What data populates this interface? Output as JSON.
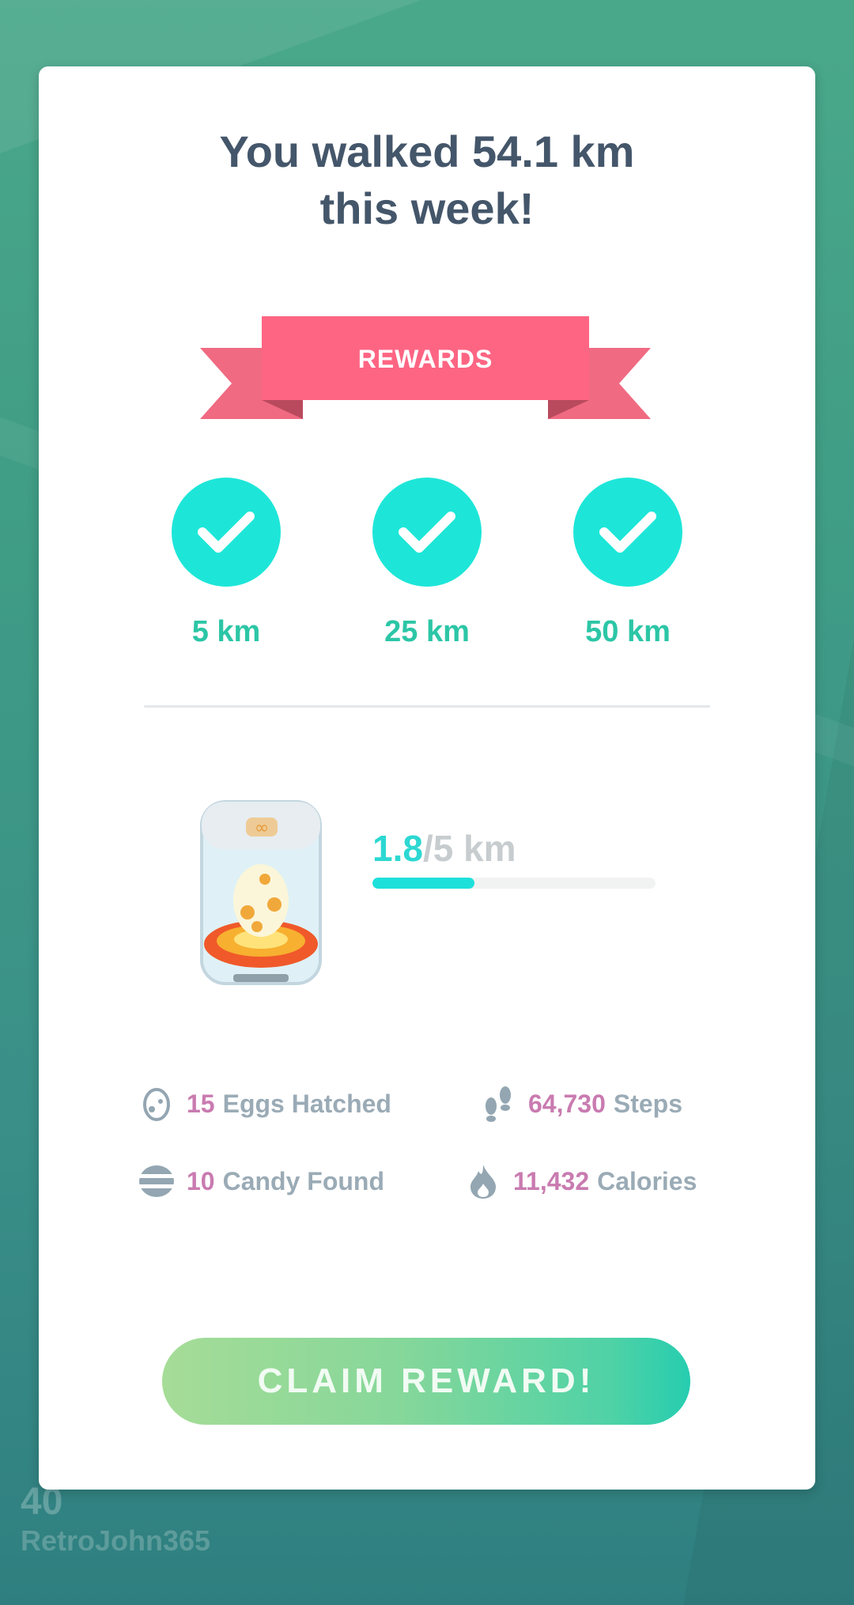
{
  "background": {
    "trainer_level": "40",
    "trainer_name": "RetroJohn365"
  },
  "dialog": {
    "title_line1": "You walked 54.1 km",
    "title_line2": "this week!",
    "rewards_label": "REWARDS",
    "milestones": [
      {
        "label": "5 km",
        "completed": true
      },
      {
        "label": "25 km",
        "completed": true
      },
      {
        "label": "50 km",
        "completed": true
      }
    ],
    "egg_progress": {
      "current": "1.8",
      "separator": "/",
      "total": "5 km",
      "fraction": 0.36
    },
    "stats": {
      "eggs": {
        "value": "15",
        "label": "Eggs Hatched",
        "icon": "egg-icon"
      },
      "steps": {
        "value": "64,730",
        "label": "Steps",
        "icon": "footprints-icon"
      },
      "candy": {
        "value": "10",
        "label": "Candy Found",
        "icon": "candy-icon"
      },
      "calories": {
        "value": "11,432",
        "label": "Calories",
        "icon": "flame-icon"
      }
    },
    "claim_button": "CLAIM REWARD!"
  },
  "colors": {
    "title": "#44566a",
    "ribbon": "#fe6583",
    "check": "#1de6d8",
    "milestone_text": "#2cc6a6",
    "stat_number": "#c97bb0",
    "stat_label": "#9aabb6",
    "progress_fill": "#1de0da"
  }
}
